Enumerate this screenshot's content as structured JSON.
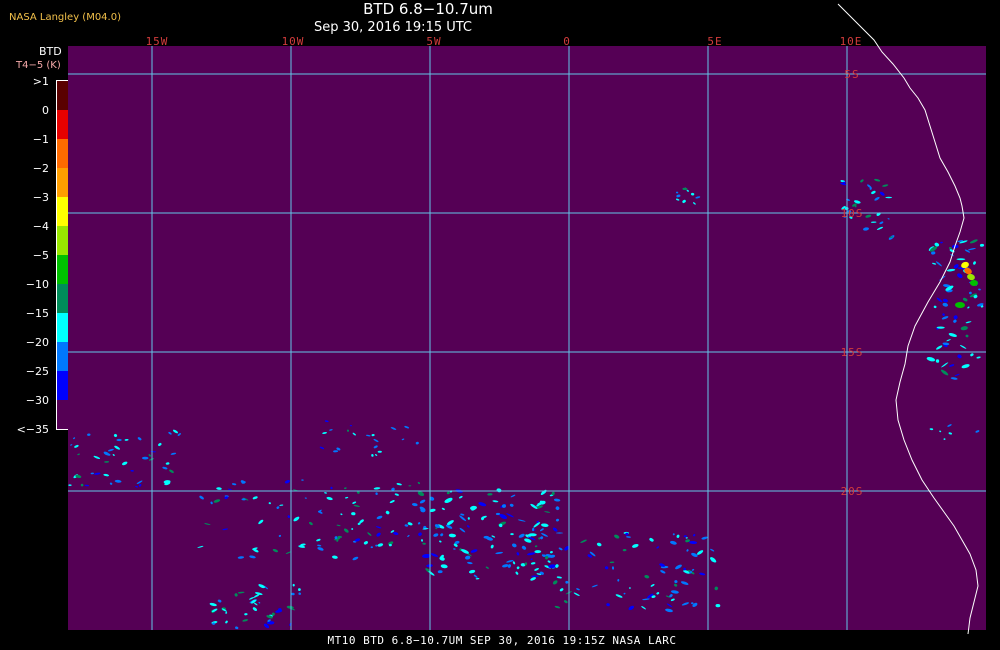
{
  "header": {
    "title": "BTD 6.8−10.7um",
    "subtitle": "Sep 30, 2016 19:15 UTC",
    "producer": "NASA Langley (M04.0)"
  },
  "legend": {
    "title_line1": "BTD",
    "title_line2": "T4−5 (K)",
    "labels": [
      ">1",
      "0",
      "−1",
      "−2",
      "−3",
      "−4",
      "−5",
      "−10",
      "−15",
      "−20",
      "−25",
      "−30",
      "<−35"
    ],
    "colors": [
      "#5a0000",
      "#e60000",
      "#ff6a00",
      "#ff9e00",
      "#ffff00",
      "#99e600",
      "#00c000",
      "#008c5a",
      "#00ffff",
      "#0078ff",
      "#0000ff",
      "#550055"
    ]
  },
  "map": {
    "background_color": "#550055",
    "grid_color": "#63c6e6",
    "coast_color": "#ffffff",
    "lon_labels": [
      "15W",
      "10W",
      "5W",
      "0",
      "5E",
      "10E"
    ],
    "lat_labels": [
      "5S",
      "10S",
      "15S",
      "20S"
    ]
  },
  "footer": {
    "text": "MT10  BTD 6.8−10.7UM   SEP 30, 2016 19:15Z   NASA LARC"
  }
}
